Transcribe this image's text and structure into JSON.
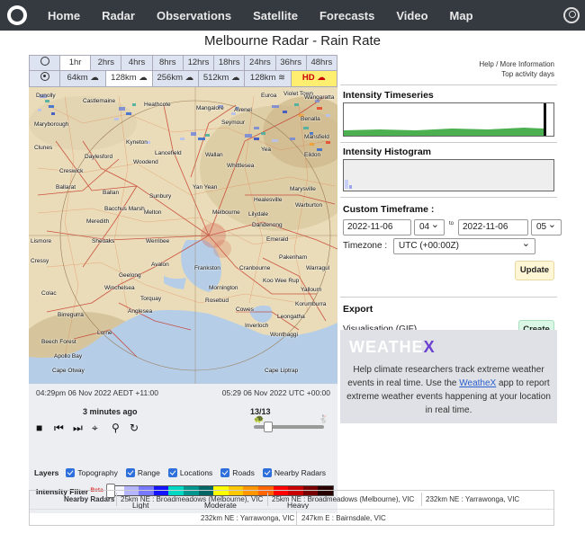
{
  "nav": {
    "items": [
      "Home",
      "Radar",
      "Observations",
      "Satellite",
      "Forecasts",
      "Video",
      "Map"
    ]
  },
  "page": {
    "title": "Melbourne Radar - Rain Rate"
  },
  "time_tabs": [
    "1hr",
    "2hrs",
    "4hrs",
    "8hrs",
    "12hrs",
    "18hrs",
    "24hrs",
    "36hrs",
    "48hrs"
  ],
  "range_tabs": [
    "64km",
    "128km",
    "256km",
    "512km",
    "128km",
    "HD"
  ],
  "map": {
    "towns": [
      "Dunolly",
      "Castlemaine",
      "Heathcote",
      "Mangalore",
      "Avenel",
      "Euroa",
      "Violet Town",
      "Benalla",
      "Wangaratta",
      "Maryborough",
      "Clunes",
      "Daylesford",
      "Kyneton",
      "Seymour",
      "Yea",
      "Mansfield",
      "Ballarat",
      "Creswick",
      "Woodend",
      "Wallan",
      "Lancefield",
      "Whittlesea",
      "Marysville",
      "Eildon",
      "Ballan",
      "Melton",
      "Sunbury",
      "Yan Yean",
      "Healesville",
      "Warburton",
      "Meredith",
      "Bacchus Marsh",
      "Melbourne",
      "Lilydale",
      "Dandenong",
      "Emerald",
      "Pakenham",
      "Warragul",
      "Lismore",
      "Sheoaks",
      "Werribee",
      "Geelong",
      "Avalon",
      "Frankston",
      "Cranbourne",
      "Koo Wee Rup",
      "Winchelsea",
      "Mornington",
      "Rosebud",
      "Cowes",
      "Korumburra",
      "Leongatha",
      "Wonthaggi",
      "Colac",
      "Torquay",
      "Anglesea",
      "Lorne",
      "Apollo Bay",
      "Cape Otway",
      "Cape Liptrap",
      "Inverloch",
      "Birregurra",
      "Beech Forest",
      "Cressy",
      "Yallourn"
    ]
  },
  "timestamps": {
    "local": "04:29pm 06 Nov 2022 AEDT +11:00",
    "utc": "05:29 06 Nov 2022 UTC +00:00"
  },
  "playback": {
    "ago": "3 minutes ago",
    "frame": "13/13"
  },
  "layers": {
    "label": "Layers",
    "items": [
      "Topography",
      "Range",
      "Locations",
      "Roads",
      "Nearby Radars"
    ]
  },
  "filter": {
    "label": "Intensity Filter",
    "beta": "Beta",
    "scale": [
      "Light",
      "Moderate",
      "Heavy"
    ]
  },
  "help": {
    "more_info": "Help / More Information",
    "top_days": "Top activity days"
  },
  "timeseries": {
    "title": "Intensity Timeseries"
  },
  "histogram": {
    "title": "Intensity Histogram"
  },
  "custom": {
    "title": "Custom Timeframe :",
    "start_date": "2022-11-06",
    "start_hour": "04",
    "to": "to",
    "end_date": "2022-11-06",
    "end_hour": "05",
    "timezone_label": "Timezone :",
    "timezone_value": "UTC (+00:00Z)",
    "update": "Update"
  },
  "export": {
    "title": "Export",
    "label": "Visualisation (GIF)",
    "create": "Create"
  },
  "weathex": {
    "logo_a": "WEATHE",
    "logo_b": "X",
    "text_1": "Help climate researchers track extreme weather events in real time. Use the",
    "link": "WeatheX",
    "text_2": "app to report extreme weather events happening at your location in real time."
  },
  "nearby": {
    "label": "Nearby Radars",
    "items": [
      "25km NE : Broadmeadows (Melbourne), VIC",
      "25km NE : Broadmeadows (Melbourne), VIC",
      "232km NE : Yarrawonga, VIC",
      "232km NE : Yarrawonga, VIC",
      "247km E : Bairnsdale, VIC"
    ]
  }
}
